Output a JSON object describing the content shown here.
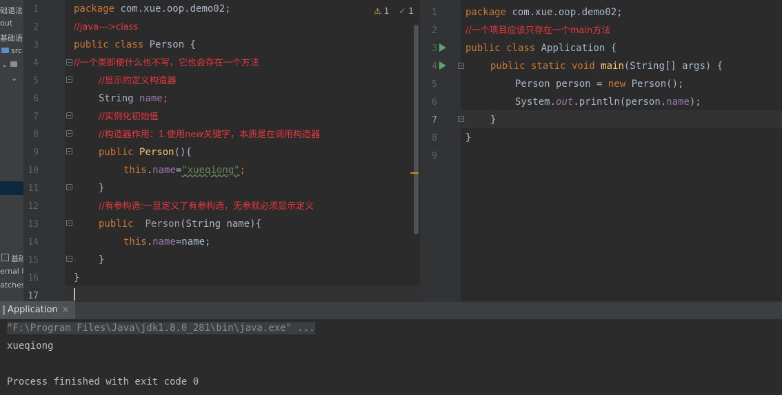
{
  "project_panel": {
    "items": [
      "础语法",
      "out",
      "基础语",
      "src",
      "基础",
      "ernal l",
      "atches"
    ]
  },
  "inspection": {
    "warning_icon": "warning-triangle-icon",
    "warning_count": "1",
    "typo_icon": "typo-check-icon",
    "typo_count": "1",
    "up_icon": "chevron-up-icon",
    "down_icon": "chevron-down-icon"
  },
  "editor_left": {
    "line_numbers": [
      "1",
      "2",
      "3",
      "4",
      "5",
      "6",
      "7",
      "8",
      "9",
      "10",
      "11",
      "12",
      "13",
      "14",
      "15",
      "16",
      "17"
    ],
    "lines": {
      "l1_kw": "package",
      "l1_rest": " com.xue.oop.demo02;",
      "l2": "//java--->class",
      "l3_kw": "public class",
      "l3_rest": " Person {",
      "l4": "//一个类即使什么也不写，它也会存在一个方法",
      "l5": "//显示的定义构造器",
      "l6_type": "String ",
      "l6_field": "name",
      "l6_end": ";",
      "l7": "//实例化初始值",
      "l8": "//构造器作用：1.使用new关键字，本质是在调用构造器",
      "l9_kw": "public ",
      "l9_fn": "Person",
      "l9_end": "(){",
      "l10_kw": "this",
      "l10_dot": ".",
      "l10_field": "name",
      "l10_eq": "=",
      "l10_str": "\"xueqiong\"",
      "l10_end": ";",
      "l11": "}",
      "l12": "//有参构造:一旦定义了有参构造，无参就必须显示定义",
      "l13_kw": "public  ",
      "l13_fn": "Person",
      "l13_end": "(String name){",
      "l14_kw": "this",
      "l14_dot": ".",
      "l14_field": "name",
      "l14_end": "=name;",
      "l15": "}",
      "l16": "}"
    }
  },
  "editor_right": {
    "line_numbers": [
      "1",
      "2",
      "3",
      "4",
      "5",
      "6",
      "7",
      "8",
      "9"
    ],
    "lines": {
      "l1_kw": "package",
      "l1_rest": " com.xue.oop.demo02;",
      "l2": "//一个项目应该只存在一个main方法",
      "l3_kw": "public class",
      "l3_rest": " Application {",
      "l4_kw": "public static void ",
      "l4_fn": "main",
      "l4_rest": "(String[] args) {",
      "l5_a": "Person person = ",
      "l5_kw": "new",
      "l5_b": " Person();",
      "l6_a": "System.",
      "l6_out": "out",
      "l6_b": ".println(person.",
      "l6_field": "name",
      "l6_c": ");",
      "l7": "}",
      "l8": "}"
    }
  },
  "run_window": {
    "tab_label": "Application",
    "close_label": "×",
    "command": "\"F:\\Program Files\\Java\\jdk1.8.0_281\\bin\\java.exe\" ...",
    "output": "xueqiong",
    "exit_message": "Process finished with exit code 0"
  },
  "colors": {
    "background": "#2b2b2b",
    "gutter": "#313335",
    "keyword": "#cc7832",
    "string": "#6a8759",
    "field": "#9876aa",
    "method": "#ffc66d",
    "comment": "#e8383d",
    "run_icon": "#59a869"
  }
}
